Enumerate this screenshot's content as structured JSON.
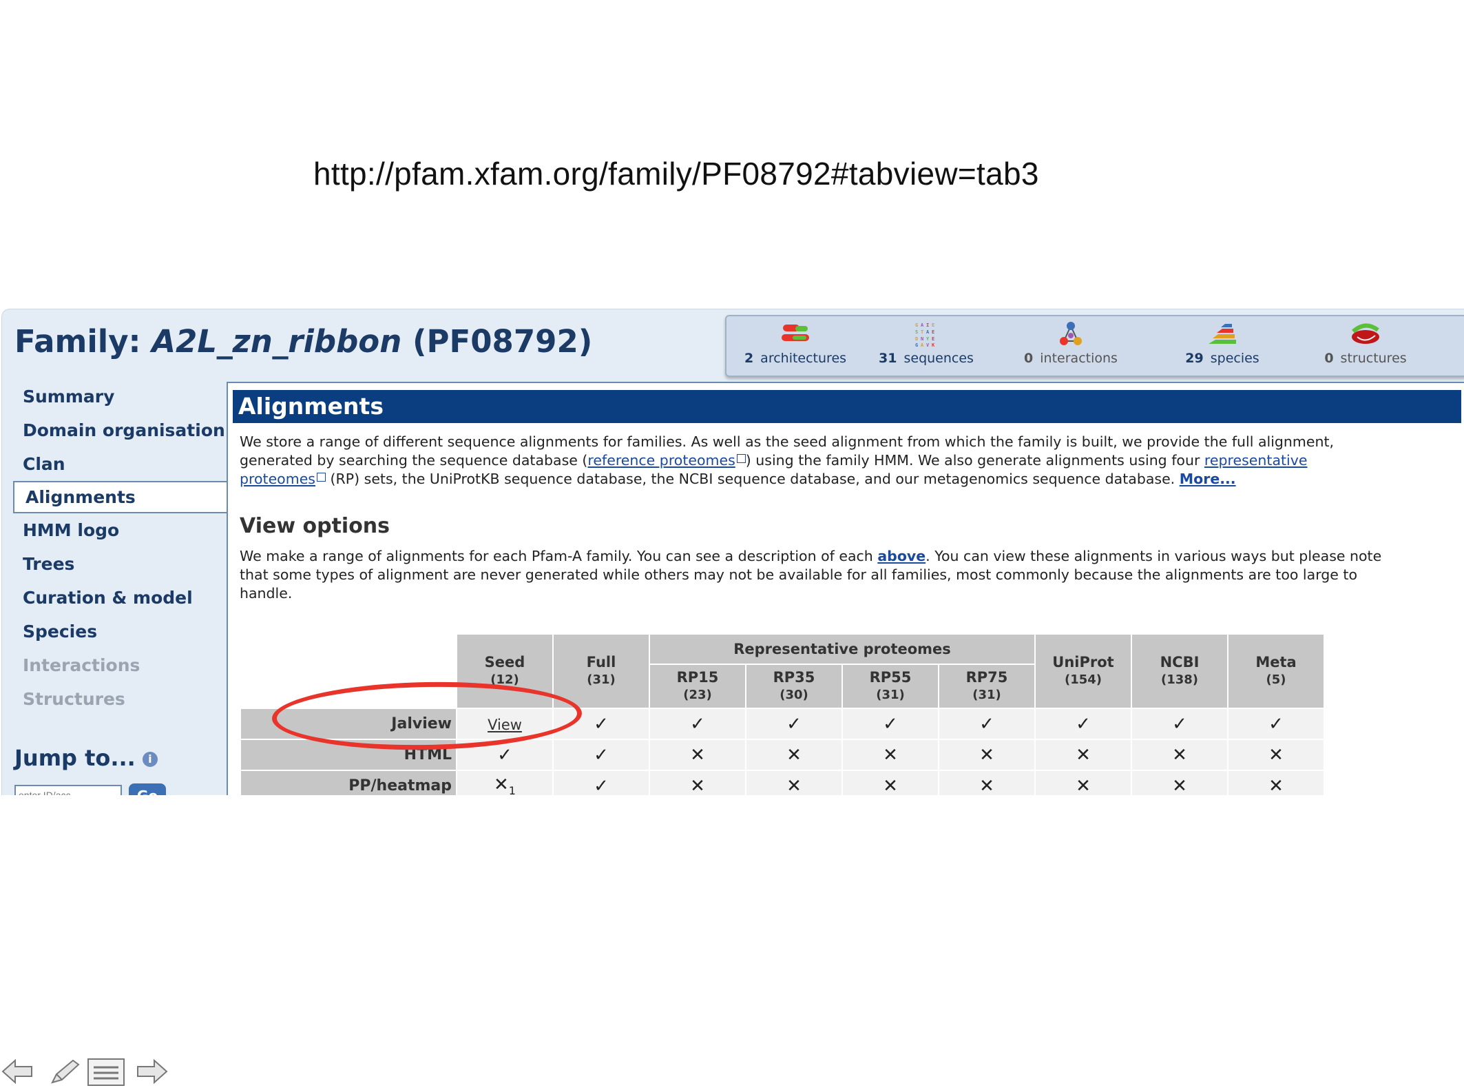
{
  "url": "http://pfam.xfam.org/family/PF08792#tabview=tab3",
  "family": {
    "prefix": "Family:",
    "name": "A2L_zn_ribbon",
    "accession": "(PF08792)"
  },
  "stats": [
    {
      "count": "2",
      "label": "architectures",
      "icon": "architectures-icon"
    },
    {
      "count": "31",
      "label": "sequences",
      "icon": "sequences-icon"
    },
    {
      "count": "0",
      "label": "interactions",
      "icon": "interactions-icon"
    },
    {
      "count": "29",
      "label": "species",
      "icon": "species-icon"
    },
    {
      "count": "0",
      "label": "structures",
      "icon": "structures-icon"
    }
  ],
  "nav": {
    "items": [
      {
        "label": "Summary",
        "state": "normal"
      },
      {
        "label": "Domain organisation",
        "state": "normal"
      },
      {
        "label": "Clan",
        "state": "normal"
      },
      {
        "label": "Alignments",
        "state": "active"
      },
      {
        "label": "HMM logo",
        "state": "normal"
      },
      {
        "label": "Trees",
        "state": "normal"
      },
      {
        "label": "Curation & model",
        "state": "normal"
      },
      {
        "label": "Species",
        "state": "normal"
      },
      {
        "label": "Interactions",
        "state": "disabled"
      },
      {
        "label": "Structures",
        "state": "disabled"
      }
    ],
    "jump_label": "Jump to...",
    "jump_placeholder": "enter ID/acc",
    "go_label": "Go"
  },
  "section_title": "Alignments",
  "intro": {
    "t1": "We store a range of different sequence alignments for families. As well as the seed alignment from which the family is built, we provide the full alignment,",
    "t2a": "generated by searching the sequence database (",
    "link_ref": "reference proteomes",
    "t2b": ") using the family HMM. We also generate alignments using four ",
    "link_rep": "representative",
    "link_prot": "proteomes",
    "t3": " (RP) sets, the UniProtKB sequence database, the NCBI sequence database, and our metagenomics sequence database. ",
    "more": "More..."
  },
  "view_options": {
    "title": "View options",
    "t1": "We make a range of alignments for each Pfam-A family. You can see a description of each ",
    "above": "above",
    "t2": ". You can view these alignments in various ways but please note",
    "t3": "that some types of alignment are never generated while others may not be available for all families, most commonly because the alignments are too large to",
    "t4": "handle."
  },
  "table": {
    "group_header": "Representative proteomes",
    "columns": [
      {
        "name": "Seed",
        "count": "(12)"
      },
      {
        "name": "Full",
        "count": "(31)"
      },
      {
        "name": "RP15",
        "count": "(23)"
      },
      {
        "name": "RP35",
        "count": "(30)"
      },
      {
        "name": "RP55",
        "count": "(31)"
      },
      {
        "name": "RP75",
        "count": "(31)"
      },
      {
        "name": "UniProt",
        "count": "(154)"
      },
      {
        "name": "NCBI",
        "count": "(138)"
      },
      {
        "name": "Meta",
        "count": "(5)"
      }
    ],
    "rows": [
      {
        "label": "Jalview",
        "seed": "View",
        "cells": [
          "✓",
          "✓",
          "✓",
          "✓",
          "✓",
          "✓",
          "✓",
          "✓"
        ]
      },
      {
        "label": "HTML",
        "seed": "✓",
        "cells": [
          "✓",
          "✕",
          "✕",
          "✕",
          "✕",
          "✕",
          "✕",
          "✕"
        ]
      },
      {
        "label": "PP/heatmap",
        "seed": "✕",
        "seed_note": "1",
        "cells": [
          "✓",
          "✕",
          "✕",
          "✕",
          "✕",
          "✕",
          "✕",
          "✕"
        ]
      }
    ]
  },
  "annotation_color": "#e8342a",
  "bottom_nav": [
    "back-arrow-icon",
    "pen-icon",
    "menu-icon",
    "forward-arrow-icon"
  ]
}
